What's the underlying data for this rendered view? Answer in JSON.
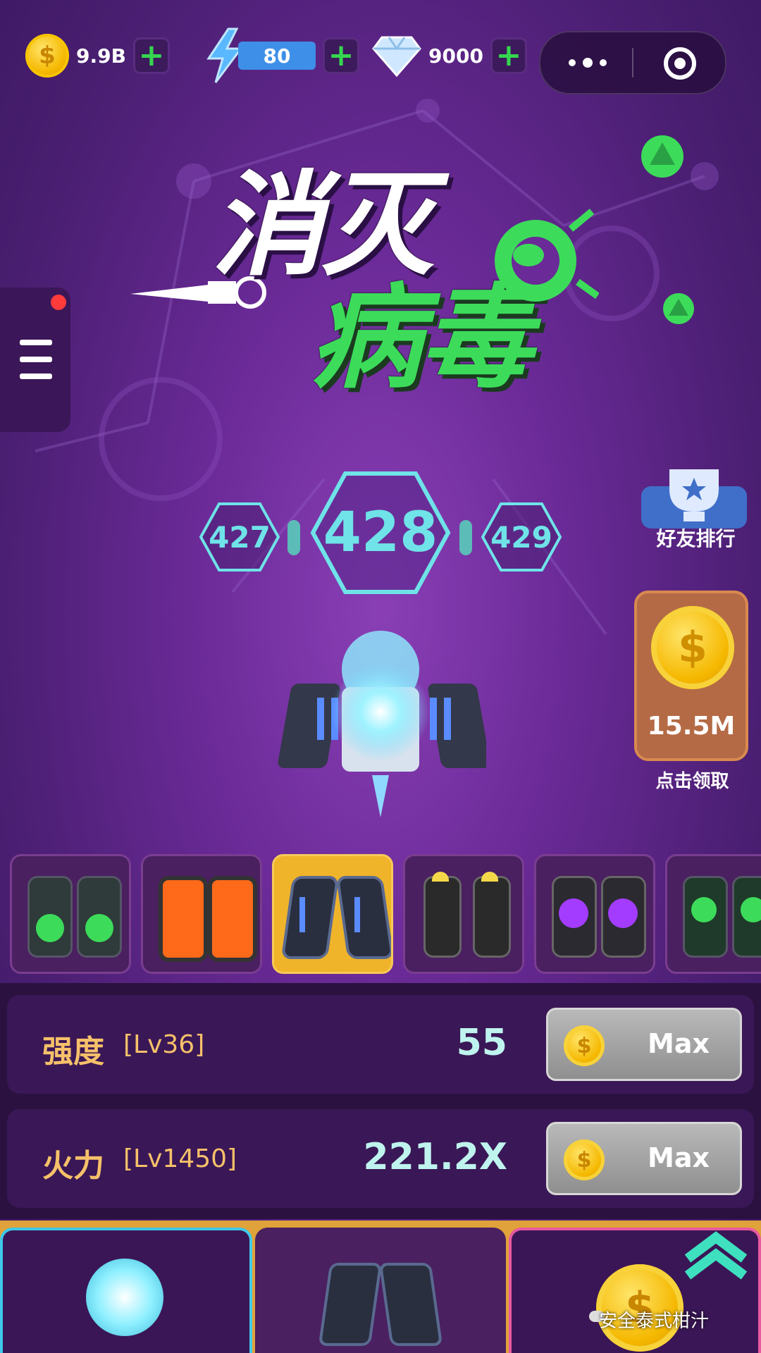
{
  "top_bar": {
    "coins": {
      "icon": "coin-icon",
      "value": "9.9B"
    },
    "energy": {
      "icon": "lightning-icon",
      "value": "80"
    },
    "gems": {
      "icon": "diamond-icon",
      "value": "9000"
    },
    "capsule": {
      "more_icon": "more-dots-icon",
      "close_icon": "target-close-icon"
    }
  },
  "logo": {
    "line1": "消灭",
    "line2": "病毒"
  },
  "levels": {
    "prev": "427",
    "current": "428",
    "next": "429"
  },
  "side": {
    "rank_label": "好友排行",
    "claim_amount": "15.5M",
    "claim_label": "点击领取"
  },
  "weapons": [
    {
      "name": "green-cannon",
      "color": "#2f3a3a",
      "accent": "#3cdc5a"
    },
    {
      "name": "orange-cannon",
      "color": "#3a2a2a",
      "accent": "#ff6a1a"
    },
    {
      "name": "blue-wing",
      "color": "#2a2f40",
      "accent": "#5a8cff",
      "selected": true
    },
    {
      "name": "yellow-missile",
      "color": "#2a2a2a",
      "accent": "#f5d84a"
    },
    {
      "name": "purple-orb",
      "color": "#2a2a30",
      "accent": "#a43cff"
    },
    {
      "name": "green-triple",
      "color": "#1f3a2a",
      "accent": "#3cdc5a"
    }
  ],
  "stats": [
    {
      "name": "强度",
      "level": "[Lv36]",
      "value": "55",
      "button": "Max"
    },
    {
      "name": "火力",
      "level": "[Lv1450]",
      "value": "221.2X",
      "button": "Max"
    }
  ],
  "bottom_nav": {
    "tabs": [
      "core-tab",
      "wing-tab",
      "coin-tab"
    ]
  },
  "watermark": "安全泰式柑汁",
  "colors": {
    "accent_green": "#3cdc5a",
    "cyan": "#6fe3e8",
    "gold": "#f5b800"
  }
}
